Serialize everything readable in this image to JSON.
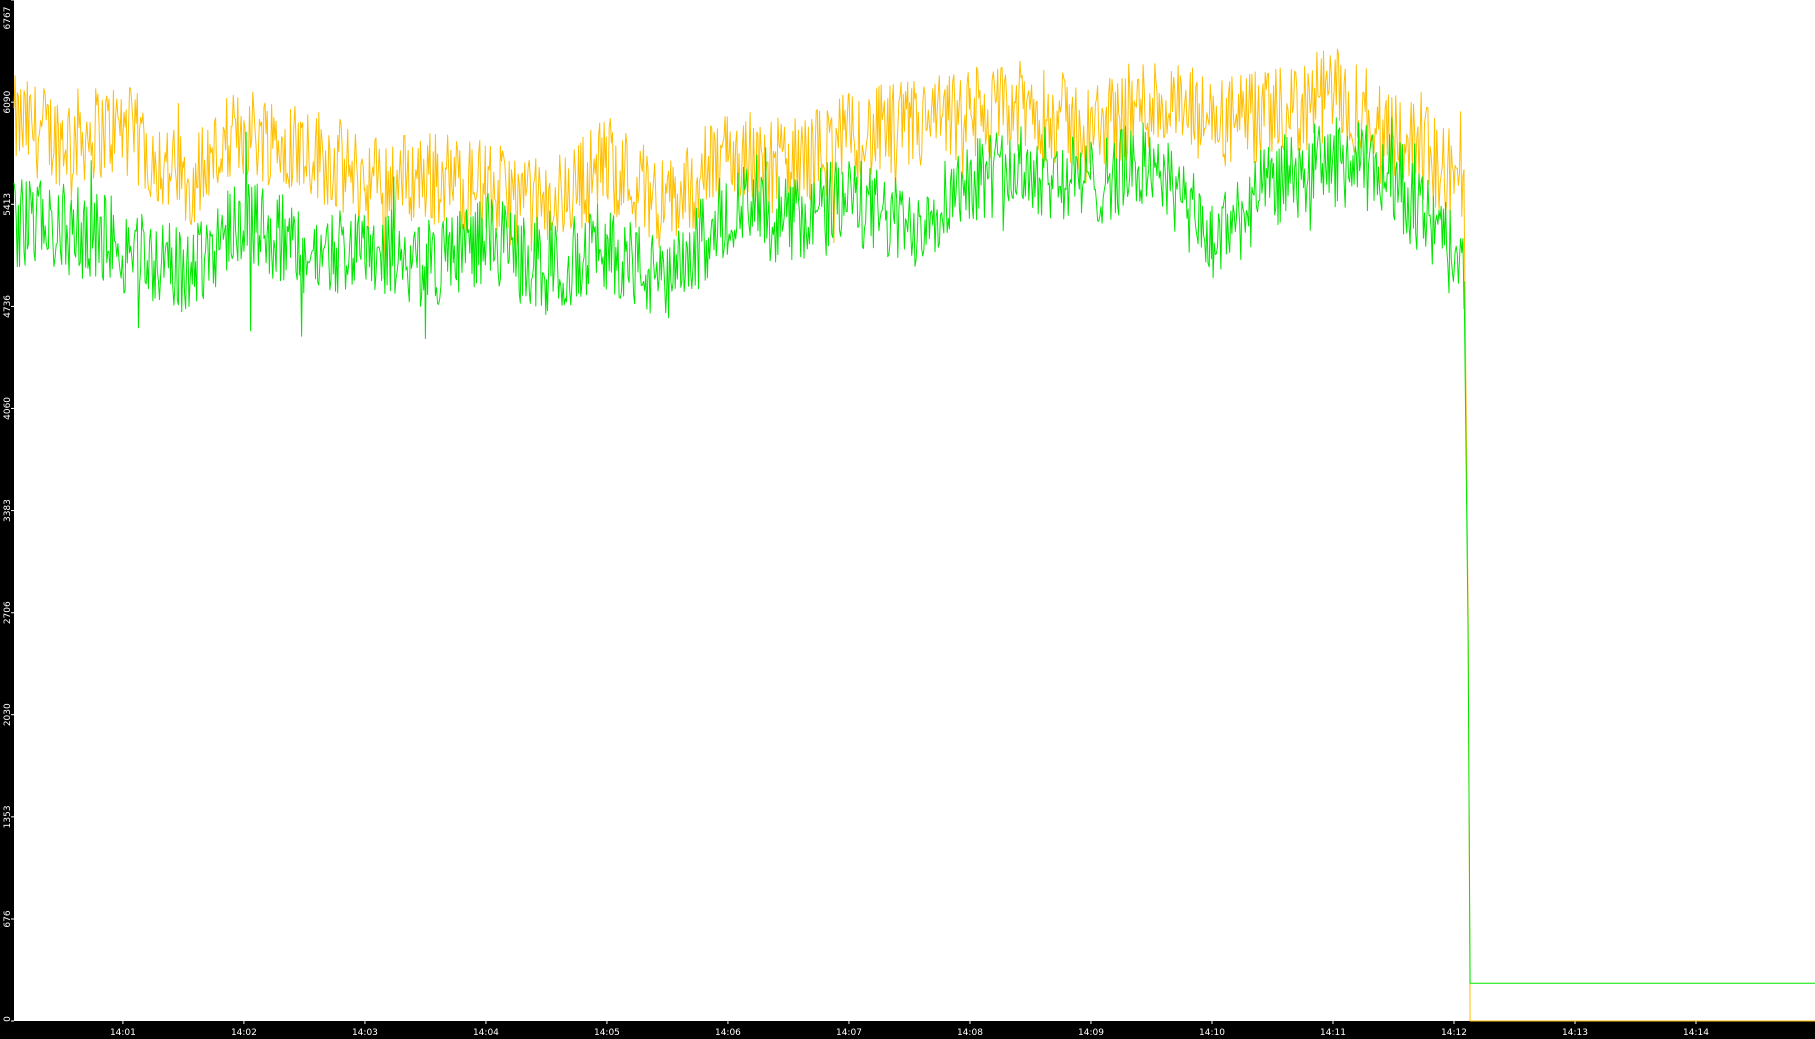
{
  "chart_data": {
    "type": "line",
    "title": "",
    "xlabel": "",
    "ylabel": "",
    "background_color": "#000000",
    "plot_background_color": "#ffffff",
    "tick_color": "#ffffff",
    "grid": false,
    "legend": "none",
    "x_domain": [
      "14:00:06",
      "14:14:59"
    ],
    "ylim": [
      0,
      6767
    ],
    "y_ticks": [
      0,
      676,
      1353,
      2030,
      2706,
      3383,
      4060,
      4736,
      5413,
      6090,
      6767
    ],
    "x_ticks": [
      "14:01",
      "14:02",
      "14:03",
      "14:04",
      "14:05",
      "14:06",
      "14:07",
      "14:08",
      "14:09",
      "14:10",
      "14:11",
      "14:12",
      "14:13",
      "14:14"
    ],
    "series": [
      {
        "color": "#ffbf00",
        "x": [
          "14:00:06",
          "14:00:30",
          "14:01:00",
          "14:01:30",
          "14:02:00",
          "14:02:30",
          "14:03:00",
          "14:03:30",
          "14:04:00",
          "14:04:30",
          "14:05:00",
          "14:05:30",
          "14:06:00",
          "14:06:30",
          "14:07:00",
          "14:07:30",
          "14:08:00",
          "14:08:30",
          "14:09:00",
          "14:09:30",
          "14:10:00",
          "14:10:30",
          "14:11:00",
          "14:11:30",
          "14:12:00",
          "14:12:05",
          "14:12:07",
          "14:12:08",
          "14:14:59"
        ],
        "values": [
          5950,
          5850,
          5920,
          5550,
          5900,
          5800,
          5560,
          5600,
          5520,
          5380,
          5700,
          5400,
          5750,
          5650,
          5850,
          5920,
          6000,
          6050,
          5900,
          6100,
          5950,
          5980,
          6150,
          5920,
          5600,
          5450,
          2706,
          0,
          0
        ]
      },
      {
        "color": "#00e600",
        "x": [
          "14:00:06",
          "14:00:30",
          "14:01:00",
          "14:01:30",
          "14:02:00",
          "14:02:30",
          "14:03:00",
          "14:03:30",
          "14:04:00",
          "14:04:30",
          "14:05:00",
          "14:05:30",
          "14:06:00",
          "14:06:30",
          "14:07:00",
          "14:07:30",
          "14:08:00",
          "14:08:30",
          "14:09:00",
          "14:09:30",
          "14:10:00",
          "14:10:30",
          "14:11:00",
          "14:11:30",
          "14:12:00",
          "14:12:05",
          "14:12:07",
          "14:12:08",
          "14:14:59"
        ],
        "values": [
          5300,
          5250,
          5150,
          4950,
          5350,
          5050,
          5150,
          5000,
          5200,
          4950,
          5150,
          4850,
          5400,
          5300,
          5450,
          5250,
          5600,
          5650,
          5550,
          5700,
          5150,
          5550,
          5700,
          5600,
          5050,
          4900,
          2550,
          250,
          250
        ]
      }
    ]
  }
}
